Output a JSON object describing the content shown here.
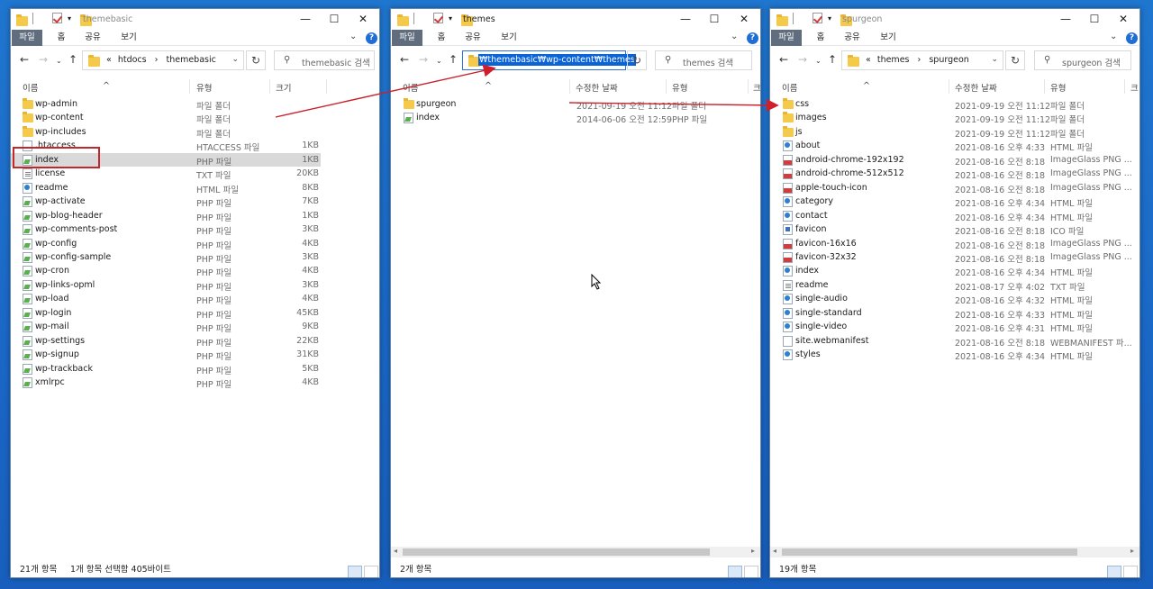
{
  "colors": {
    "desktop": "#1a67c6",
    "selection_red": "#c0282e",
    "file_tab": "#5f6d7e",
    "help": "#1e6ed6"
  },
  "ribbon": {
    "file": "파일",
    "home": "홈",
    "share": "공유",
    "view": "보기"
  },
  "icons": {
    "back": "back-arrow-icon",
    "forward": "forward-arrow-icon",
    "recent": "chevron-down-icon",
    "up": "up-arrow-icon",
    "refresh": "refresh-icon",
    "search": "search-icon",
    "help": "help-icon"
  },
  "window_controls": {
    "minimize": "—",
    "maximize": "☐",
    "close": "✕"
  },
  "windows": [
    {
      "title": "themebasic",
      "address": {
        "prefix": "«",
        "path": [
          "htdocs",
          "themebasic"
        ],
        "sep": "›"
      },
      "search_placeholder": "themebasic 검색",
      "columns": {
        "name": "이름",
        "type": "유형",
        "size": "크기"
      },
      "rows": [
        {
          "name": "wp-admin",
          "type": "파일 폴더",
          "size": "",
          "icon": "folder"
        },
        {
          "name": "wp-content",
          "type": "파일 폴더",
          "size": "",
          "icon": "folder"
        },
        {
          "name": "wp-includes",
          "type": "파일 폴더",
          "size": "",
          "icon": "folder"
        },
        {
          "name": ".htaccess",
          "type": "HTACCESS 파일",
          "size": "1KB",
          "icon": "file"
        },
        {
          "name": "index",
          "type": "PHP 파일",
          "size": "1KB",
          "icon": "php"
        },
        {
          "name": "license",
          "type": "TXT 파일",
          "size": "20KB",
          "icon": "txt"
        },
        {
          "name": "readme",
          "type": "HTML 파일",
          "size": "8KB",
          "icon": "html"
        },
        {
          "name": "wp-activate",
          "type": "PHP 파일",
          "size": "7KB",
          "icon": "php"
        },
        {
          "name": "wp-blog-header",
          "type": "PHP 파일",
          "size": "1KB",
          "icon": "php"
        },
        {
          "name": "wp-comments-post",
          "type": "PHP 파일",
          "size": "3KB",
          "icon": "php"
        },
        {
          "name": "wp-config",
          "type": "PHP 파일",
          "size": "4KB",
          "icon": "php"
        },
        {
          "name": "wp-config-sample",
          "type": "PHP 파일",
          "size": "3KB",
          "icon": "php"
        },
        {
          "name": "wp-cron",
          "type": "PHP 파일",
          "size": "4KB",
          "icon": "php"
        },
        {
          "name": "wp-links-opml",
          "type": "PHP 파일",
          "size": "3KB",
          "icon": "php"
        },
        {
          "name": "wp-load",
          "type": "PHP 파일",
          "size": "4KB",
          "icon": "php"
        },
        {
          "name": "wp-login",
          "type": "PHP 파일",
          "size": "45KB",
          "icon": "php"
        },
        {
          "name": "wp-mail",
          "type": "PHP 파일",
          "size": "9KB",
          "icon": "php"
        },
        {
          "name": "wp-settings",
          "type": "PHP 파일",
          "size": "22KB",
          "icon": "php"
        },
        {
          "name": "wp-signup",
          "type": "PHP 파일",
          "size": "31KB",
          "icon": "php"
        },
        {
          "name": "wp-trackback",
          "type": "PHP 파일",
          "size": "5KB",
          "icon": "php"
        },
        {
          "name": "xmlrpc",
          "type": "PHP 파일",
          "size": "4KB",
          "icon": "php"
        }
      ],
      "status": {
        "count": "21개 항목",
        "selection": "1개 항목 선택함 405바이트"
      }
    },
    {
      "title": "themes",
      "address": {
        "full": "₩themebasic₩wp-content₩themes"
      },
      "search_placeholder": "themes 검색",
      "columns": {
        "name": "이름",
        "date": "수정한 날짜",
        "type": "유형",
        "size": "크"
      },
      "rows": [
        {
          "name": "spurgeon",
          "date": "2021-09-19 오전 11:12",
          "type": "파일 폴더",
          "icon": "folder"
        },
        {
          "name": "index",
          "date": "2014-06-06 오전 12:59",
          "type": "PHP 파일",
          "icon": "php"
        }
      ],
      "status": {
        "count": "2개 항목"
      }
    },
    {
      "title": "spurgeon",
      "address": {
        "prefix": "«",
        "path": [
          "themes",
          "spurgeon"
        ],
        "sep": "›"
      },
      "search_placeholder": "spurgeon 검색",
      "columns": {
        "name": "이름",
        "date": "수정한 날짜",
        "type": "유형",
        "size": "크"
      },
      "rows": [
        {
          "name": "css",
          "date": "2021-09-19 오전 11:12",
          "type": "파일 폴더",
          "icon": "folder"
        },
        {
          "name": "images",
          "date": "2021-09-19 오전 11:12",
          "type": "파일 폴더",
          "icon": "folder"
        },
        {
          "name": "js",
          "date": "2021-09-19 오전 11:12",
          "type": "파일 폴더",
          "icon": "folder"
        },
        {
          "name": "about",
          "date": "2021-08-16 오후 4:33",
          "type": "HTML 파일",
          "icon": "html"
        },
        {
          "name": "android-chrome-192x192",
          "date": "2021-08-16 오전 8:18",
          "type": "ImageGlass PNG ...",
          "icon": "png"
        },
        {
          "name": "android-chrome-512x512",
          "date": "2021-08-16 오전 8:18",
          "type": "ImageGlass PNG ...",
          "icon": "png"
        },
        {
          "name": "apple-touch-icon",
          "date": "2021-08-16 오전 8:18",
          "type": "ImageGlass PNG ...",
          "icon": "png"
        },
        {
          "name": "category",
          "date": "2021-08-16 오후 4:34",
          "type": "HTML 파일",
          "icon": "html"
        },
        {
          "name": "contact",
          "date": "2021-08-16 오후 4:34",
          "type": "HTML 파일",
          "icon": "html"
        },
        {
          "name": "favicon",
          "date": "2021-08-16 오전 8:18",
          "type": "ICO 파일",
          "icon": "ico"
        },
        {
          "name": "favicon-16x16",
          "date": "2021-08-16 오전 8:18",
          "type": "ImageGlass PNG ...",
          "icon": "png"
        },
        {
          "name": "favicon-32x32",
          "date": "2021-08-16 오전 8:18",
          "type": "ImageGlass PNG ...",
          "icon": "png"
        },
        {
          "name": "index",
          "date": "2021-08-16 오후 4:34",
          "type": "HTML 파일",
          "icon": "html"
        },
        {
          "name": "readme",
          "date": "2021-08-17 오후 4:02",
          "type": "TXT 파일",
          "icon": "txt"
        },
        {
          "name": "single-audio",
          "date": "2021-08-16 오후 4:32",
          "type": "HTML 파일",
          "icon": "html"
        },
        {
          "name": "single-standard",
          "date": "2021-08-16 오후 4:33",
          "type": "HTML 파일",
          "icon": "html"
        },
        {
          "name": "single-video",
          "date": "2021-08-16 오후 4:31",
          "type": "HTML 파일",
          "icon": "html"
        },
        {
          "name": "site.webmanifest",
          "date": "2021-08-16 오전 8:18",
          "type": "WEBMANIFEST 파...",
          "icon": "file"
        },
        {
          "name": "styles",
          "date": "2021-08-16 오후 4:34",
          "type": "HTML 파일",
          "icon": "html"
        }
      ],
      "status": {
        "count": "19개 항목"
      }
    }
  ]
}
